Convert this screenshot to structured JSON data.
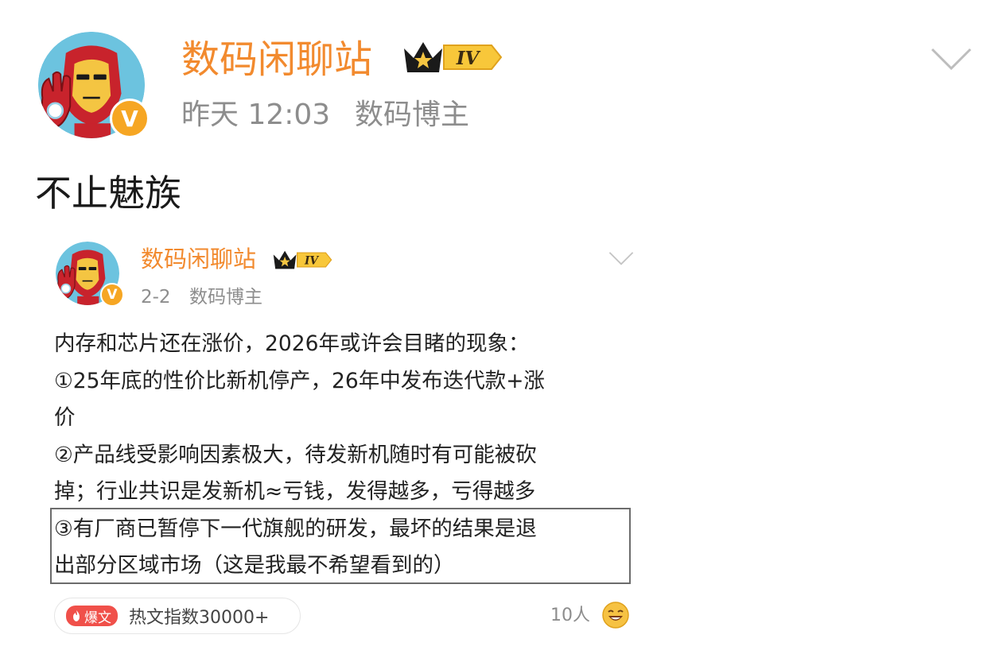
{
  "outer_post": {
    "author": "数码闲聊站",
    "level": "IV",
    "verified_mark": "V",
    "time": "昨天 12:03",
    "account_type": "数码博主",
    "text": "不止魅族",
    "icons": [
      "avatar-iron-man",
      "crown-level-icon",
      "chevron-down-icon"
    ]
  },
  "quoted_post": {
    "author": "数码闲聊站",
    "level": "IV",
    "verified_mark": "V",
    "time": "2-2",
    "account_type": "数码博主",
    "lines": [
      "内存和芯片还在涨价，2026年或许会目睹的现象：",
      "①25年底的性价比新机停产，26年中发布迭代款+涨",
      "价",
      "②产品线受影响因素极大，待发新机随时有可能被砍",
      "掉；行业共识是发新机≈亏钱，发得越多，亏得越多",
      "③有厂商已暂停下一代旗舰的研发，最坏的结果是退",
      "出部分区域市场（这是我最不希望看到的）"
    ],
    "hot_badge": "爆文",
    "hot_index": "热文指数30000+",
    "reaction_count": "10人",
    "colors": {
      "author": "#f28a2e",
      "meta": "#8d8d8d",
      "hot": "#f0504a",
      "verified": "#f6a623"
    }
  }
}
